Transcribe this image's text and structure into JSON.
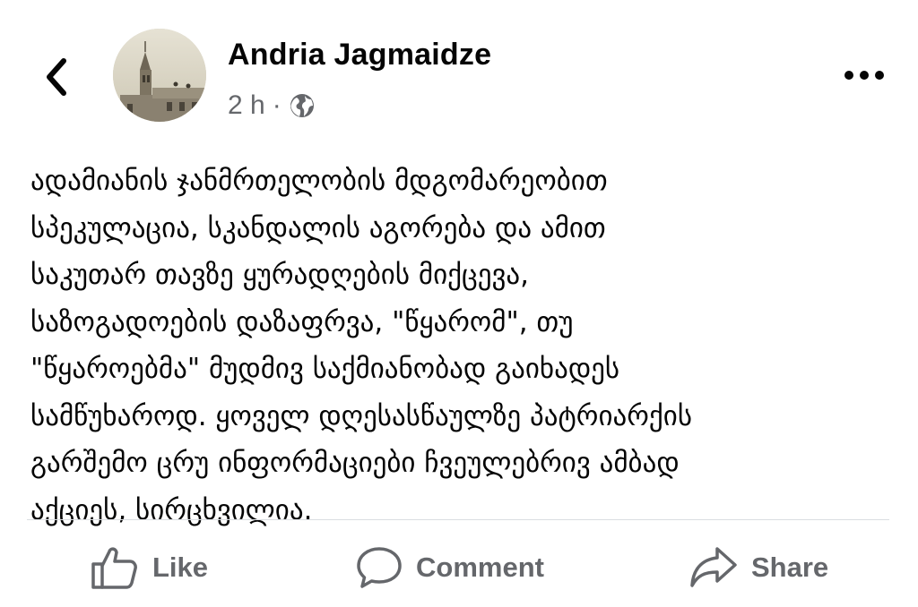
{
  "post": {
    "author": "Andria Jagmaidze",
    "time": "2 h",
    "separator": "·",
    "privacy_icon": "globe-icon",
    "text": "ადამიანის ჯანმრთელობის მდგომარეობით\nსპეკულაცია, სკანდალის აგორება და ამით\nსაკუთარ თავზე ყურადღების მიქცევა,\nსაზოგადოების დაზაფრვა, \"წყარომ\",  თუ\n\"წყაროებმა\" მუდმივ საქმიანობად გაიხადეს\nსამწუხაროდ. ყოველ დღესასწაულზე პატრიარქის\nგარშემო  ცრუ ინფორმაციები ჩვეულებრივ ამბად\nაქციეს, სირცხვილია."
  },
  "actions": {
    "like": "Like",
    "comment": "Comment",
    "share": "Share"
  },
  "colors": {
    "text": "#050505",
    "secondary": "#65676b",
    "divider": "#dadde1"
  },
  "icons": [
    "back-chevron-icon",
    "more-dots-icon",
    "globe-icon",
    "thumbs-up-icon",
    "comment-icon",
    "share-arrow-icon"
  ]
}
